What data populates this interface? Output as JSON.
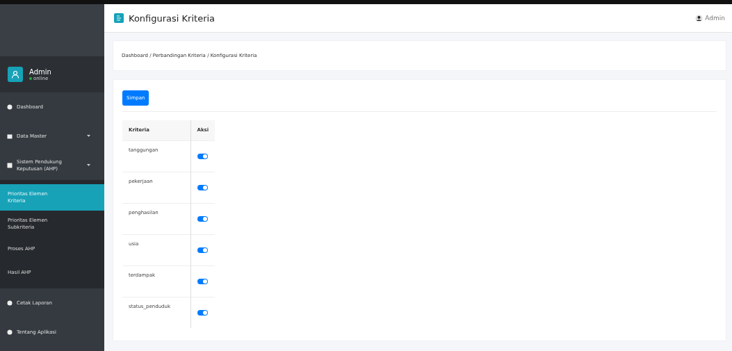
{
  "sidebar": {
    "user": {
      "name": "Admin",
      "status": "online"
    },
    "items": [
      {
        "label": "Dashboard",
        "selected": false,
        "has_caret": false
      },
      {
        "label": "Data Master",
        "selected": false,
        "has_caret": true
      },
      {
        "label": "Sistem Pendukung Keputusan (AHP)",
        "selected": false,
        "has_caret": true,
        "expanded": true,
        "children": [
          {
            "label": "Prioritas Elemen Kriteria",
            "selected": true
          },
          {
            "label": "Prioritas Elemen Subkriteria",
            "selected": false
          },
          {
            "label": "Proses AHP",
            "selected": false
          },
          {
            "label": "Hasil AHP",
            "selected": false
          }
        ]
      },
      {
        "label": "Cetak Laporan",
        "selected": false,
        "has_caret": false
      },
      {
        "label": "Tentang Aplikasi",
        "selected": false,
        "has_caret": false
      }
    ]
  },
  "header": {
    "title": "Konfigurasi Kriteria",
    "user": "Admin"
  },
  "breadcrumb": "Dashboard / Perbandingan Kriteria / Konfigurasi Kriteria",
  "save_button": "Simpan",
  "table": {
    "columns": [
      "Kriteria",
      "Aksi"
    ],
    "rows": [
      {
        "name": "tanggungan",
        "on": true
      },
      {
        "name": "pekerjaan",
        "on": true
      },
      {
        "name": "penghasilan",
        "on": true
      },
      {
        "name": "usia",
        "on": true
      },
      {
        "name": "terdampak",
        "on": true
      },
      {
        "name": "status_penduduk",
        "on": true
      }
    ]
  }
}
